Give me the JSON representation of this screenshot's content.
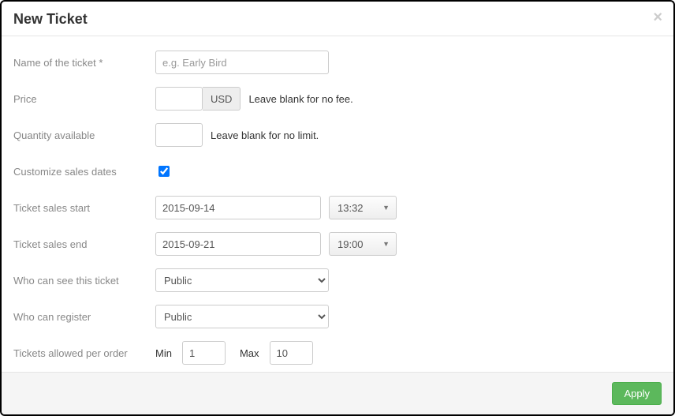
{
  "header": {
    "title": "New Ticket"
  },
  "form": {
    "name": {
      "label": "Name of the ticket *",
      "placeholder": "e.g. Early Bird",
      "value": ""
    },
    "price": {
      "label": "Price",
      "value": "",
      "currency": "USD",
      "hint": "Leave blank for no fee."
    },
    "quantity": {
      "label": "Quantity available",
      "value": "",
      "hint": "Leave blank for no limit."
    },
    "customize": {
      "label": "Customize sales dates",
      "checked": true
    },
    "sales_start": {
      "label": "Ticket sales start",
      "date": "2015-09-14",
      "time": "13:32"
    },
    "sales_end": {
      "label": "Ticket sales end",
      "date": "2015-09-21",
      "time": "19:00"
    },
    "visibility": {
      "label": "Who can see this ticket",
      "value": "Public"
    },
    "register": {
      "label": "Who can register",
      "value": "Public"
    },
    "per_order": {
      "label": "Tickets allowed per order",
      "min_label": "Min",
      "min_value": "1",
      "max_label": "Max",
      "max_value": "10"
    }
  },
  "footer": {
    "apply": "Apply"
  }
}
